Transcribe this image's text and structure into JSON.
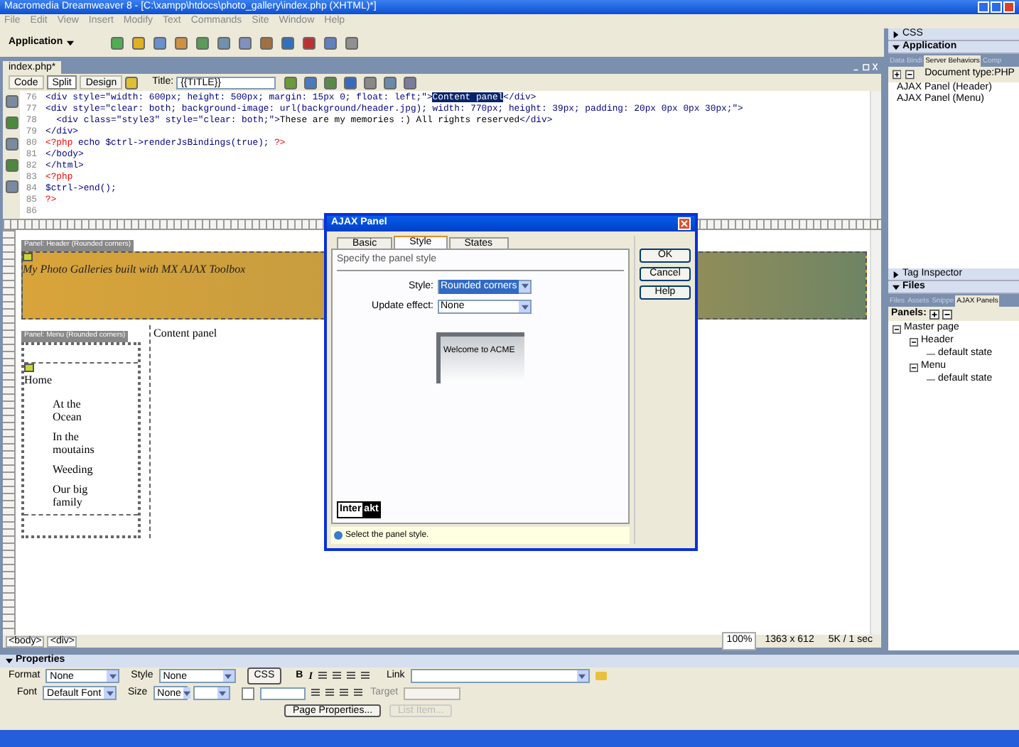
{
  "window": {
    "title": "Macromedia Dreamweaver 8 - [C:\\xampp\\htdocs\\photo_gallery\\index.php (XHTML)*]"
  },
  "menu": [
    "File",
    "Edit",
    "View",
    "Insert",
    "Modify",
    "Text",
    "Commands",
    "Site",
    "Window",
    "Help"
  ],
  "toolbar": {
    "category": "Application"
  },
  "document": {
    "tab": "index.php*",
    "view_buttons": [
      {
        "label": "Code",
        "selected": false
      },
      {
        "label": "Split",
        "selected": true
      },
      {
        "label": "Design",
        "selected": false
      }
    ],
    "title_label": "Title:",
    "title_value": "{{TITLE}}",
    "code_lines": [
      {
        "number": "76",
        "segments": [
          {
            "kind": "tag",
            "text": "<div style=\"width: 600px; height: 500px; margin: 15px 0; float: left;\">"
          },
          {
            "kind": "selected",
            "text": "Content panel"
          },
          {
            "kind": "tag",
            "text": "</div>"
          }
        ]
      },
      {
        "number": "77",
        "segments": [
          {
            "kind": "tag",
            "text": "<div style=\"clear: both; background-image: url(background/header.jpg); width: 770px; height: 39px; padding: 20px 0px 0px 30px;\">"
          }
        ]
      },
      {
        "number": "78",
        "segments": [
          {
            "kind": "tag",
            "text": "  <div class=\"style3\" style=\"clear: both;\">"
          },
          {
            "kind": "plain",
            "text": "These are my memories :) All rights reserved"
          },
          {
            "kind": "tag",
            "text": "</div>"
          }
        ]
      },
      {
        "number": "79",
        "segments": [
          {
            "kind": "tag",
            "text": "</div>"
          }
        ]
      },
      {
        "number": "80",
        "segments": [
          {
            "kind": "php",
            "text": "<?php"
          },
          {
            "kind": "script",
            "text": " echo $ctrl->renderJsBindings(true); "
          },
          {
            "kind": "php",
            "text": "?>"
          }
        ]
      },
      {
        "number": "81",
        "segments": [
          {
            "kind": "tag",
            "text": "</body>"
          }
        ]
      },
      {
        "number": "82",
        "segments": [
          {
            "kind": "tag",
            "text": "</html>"
          }
        ]
      },
      {
        "number": "83",
        "segments": [
          {
            "kind": "php",
            "text": "<?php"
          }
        ]
      },
      {
        "number": "84",
        "segments": [
          {
            "kind": "script",
            "text": "$ctrl->end();"
          }
        ]
      },
      {
        "number": "85",
        "segments": [
          {
            "kind": "php",
            "text": "?>"
          }
        ]
      },
      {
        "number": "86"
      }
    ],
    "design": {
      "header_label": "Panel: Header (Rounded corners)",
      "header_text": "My Photo Galleries built with MX AJAX Toolbox",
      "menu_label": "Panel: Menu (Rounded corners)",
      "menu_home": "Home",
      "menu_items": [
        "At the Ocean",
        "In the moutains",
        "Weeding",
        "Our big family"
      ],
      "content_text": "Content panel"
    },
    "tag_selector": [
      "<body>",
      "<div>"
    ],
    "zoom": "100%",
    "size": "1363 x 612",
    "download": "5K / 1 sec"
  },
  "dialog": {
    "title": "AJAX Panel",
    "tabs": [
      {
        "label": "Basic",
        "selected": false
      },
      {
        "label": "Style",
        "selected": true
      },
      {
        "label": "States",
        "selected": false
      }
    ],
    "section": "Specify the panel style",
    "fields": [
      {
        "label": "Style:",
        "value": "Rounded corners",
        "highlighted": true
      },
      {
        "label": "Update effect:",
        "value": "None",
        "highlighted": false
      }
    ],
    "preview_text": "Welcome to ACME",
    "logo_left": "Inter",
    "logo_right": "akt",
    "buttons": [
      "OK",
      "Cancel",
      "Help"
    ],
    "hint": "Select the panel style."
  },
  "properties": {
    "title": "Properties",
    "format_label": "Format",
    "format_value": "None",
    "style_label": "Style",
    "style_value": "None",
    "css_button": "CSS",
    "bold": "B",
    "italic": "I",
    "link_label": "Link",
    "font_label": "Font",
    "font_value": "Default Font",
    "size_label": "Size",
    "size_value": "None",
    "target_label": "Target",
    "buttons": [
      {
        "label": "Page Properties...",
        "disabled": false
      },
      {
        "label": "List Item...",
        "disabled": true
      }
    ]
  },
  "side_panels": [
    {
      "title": "CSS",
      "expanded": false
    },
    {
      "title": "Application",
      "expanded": true,
      "tabs": [
        {
          "label": "Data Bindi",
          "selected": false
        },
        {
          "label": "Server Behaviors",
          "selected": true
        },
        {
          "label": "Comp",
          "selected": false
        }
      ],
      "doc_type": "Document type:PHP",
      "items": [
        "AJAX Panel (Header)",
        "AJAX Panel (Menu)"
      ]
    },
    {
      "title": "Tag Inspector",
      "expanded": false
    },
    {
      "title": "Files",
      "expanded": true,
      "tabs": [
        {
          "label": "Files",
          "selected": false
        },
        {
          "label": "Assets",
          "selected": false
        },
        {
          "label": "Snippe",
          "selected": false
        },
        {
          "label": "AJAX Panels",
          "selected": true
        }
      ],
      "panels_label": "Panels:",
      "tree": [
        {
          "label": "Master page",
          "expanded": true,
          "children": [
            {
              "label": "Header",
              "expanded": true,
              "children": [
                {
                  "label": "default state"
                }
              ]
            },
            {
              "label": "Menu",
              "expanded": true,
              "children": [
                {
                  "label": "default state"
                }
              ]
            }
          ]
        }
      ]
    }
  ]
}
